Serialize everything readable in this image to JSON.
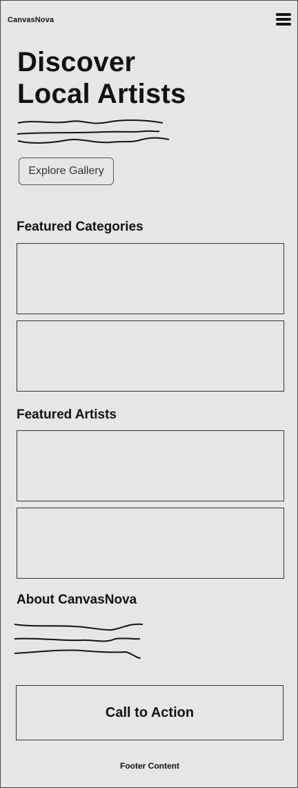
{
  "header": {
    "brand": "CanvasNova",
    "menu_icon": "hamburger-menu-icon"
  },
  "hero": {
    "title_line1": "Discover",
    "title_line2": "Local Artists",
    "button_label": "Explore Gallery"
  },
  "sections": {
    "categories_title": "Featured Categories",
    "artists_title": "Featured Artists",
    "about_title": "About CanvasNova"
  },
  "cta": {
    "label": "Call to Action"
  },
  "footer": {
    "text": "Footer Content"
  }
}
